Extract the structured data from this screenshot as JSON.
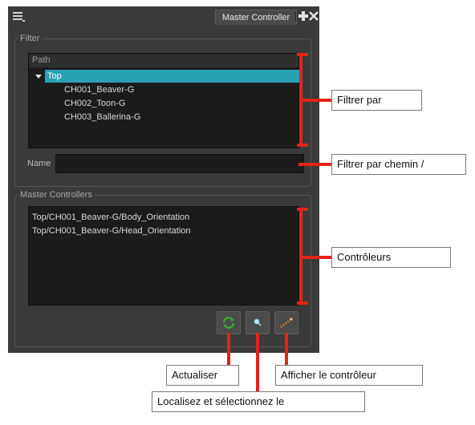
{
  "panel": {
    "tab_title": "Master Controller",
    "filter_group": "Filter",
    "tree": {
      "header": "Path",
      "root": "Top",
      "children": [
        "CH001_Beaver-G",
        "CH002_Toon-G",
        "CH003_Ballerina-G"
      ]
    },
    "name_label": "Name",
    "name_value": "",
    "master_group": "Master Controllers",
    "controllers": [
      "Top/CH001_Beaver-G/Body_Orientation",
      "Top/CH001_Beaver-G/Head_Orientation"
    ]
  },
  "callouts": {
    "filter_by": "Filtrer par",
    "filter_by_path_name": "Filtrer par chemin /",
    "controllers": "Contrôleurs",
    "refresh": "Actualiser",
    "locate_select": "Localisez et sélectionnez le",
    "show_controller": "Afficher le contrôleur"
  },
  "colors": {
    "panel_bg": "#3a3a3a",
    "selection": "#2aa0b3",
    "callout_line": "#e2231a"
  },
  "icons": {
    "menu": "menu-icon",
    "add": "add-icon",
    "close": "close-icon",
    "refresh": "refresh-icon",
    "locate": "locate-icon",
    "show": "show-controller-icon"
  }
}
